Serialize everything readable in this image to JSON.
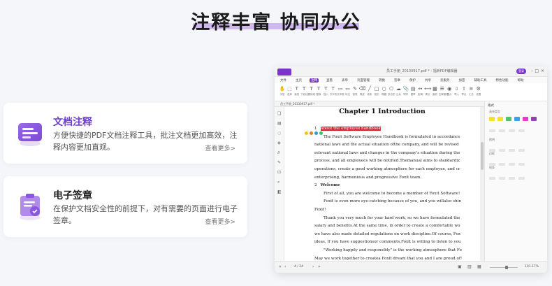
{
  "header": {
    "title": "注释丰富 协同办公"
  },
  "features": [
    {
      "title": "文档注释",
      "description": "方便快捷的PDF文档注释工具，批注文档更加高效，注释内容更加直观。",
      "link": "查看更多>",
      "icon": "annotation-icon",
      "accent": "#7b44d6"
    },
    {
      "title": "电子签章",
      "description": "在保护文档安全性的前提下，对有需要的页面进行电子签章。",
      "link": "查看更多>",
      "icon": "stamp-icon",
      "accent": "#9a6de3"
    }
  ],
  "app": {
    "window_title": "员工手册_20130917.pdf * - 福昕PDF编辑器",
    "login_label": "登录",
    "menus": [
      "文件",
      "主页",
      "注释",
      "查看",
      "表单",
      "页面管理",
      "转换",
      "签章",
      "保护",
      "共享",
      "云服务",
      "加密",
      "辅助工具",
      "特色功能",
      "帮助"
    ],
    "active_menu": "注释",
    "tools": [
      {
        "label": "手型",
        "glyph": "✋"
      },
      {
        "label": "选择",
        "glyph": "⬚"
      },
      {
        "label": "高亮",
        "glyph": "T"
      },
      {
        "label": "下划线",
        "glyph": "T"
      },
      {
        "label": "删除线",
        "glyph": "T"
      },
      {
        "label": "替换",
        "glyph": "T"
      },
      {
        "label": "插入",
        "glyph": "T"
      },
      {
        "label": "打字机",
        "glyph": "T"
      },
      {
        "label": "文本框",
        "glyph": "▭"
      },
      {
        "label": "标注",
        "glyph": "▭"
      },
      {
        "label": "铅笔",
        "glyph": "✎"
      },
      {
        "label": "橡皮",
        "glyph": "⌫"
      },
      {
        "label": "线条",
        "glyph": "╱"
      },
      {
        "label": "矩形",
        "glyph": "□"
      },
      {
        "label": "椭圆",
        "glyph": "○"
      },
      {
        "label": "多边形",
        "glyph": "⬠"
      },
      {
        "label": "云朵",
        "glyph": "☁"
      },
      {
        "label": "附件",
        "glyph": "📎"
      },
      {
        "label": "图章",
        "glyph": "▤"
      },
      {
        "label": "距离",
        "glyph": "↔"
      },
      {
        "label": "周长",
        "glyph": "⟷"
      },
      {
        "label": "面积",
        "glyph": "▦"
      },
      {
        "label": "注释管理",
        "glyph": "☰"
      },
      {
        "label": "显示",
        "glyph": "◉"
      },
      {
        "label": "导入",
        "glyph": "⇩"
      },
      {
        "label": "导出",
        "glyph": "⇧"
      },
      {
        "label": "汇总",
        "glyph": "≡"
      },
      {
        "label": "设置",
        "glyph": "⚙"
      }
    ],
    "doc_tab": "员工手册_20130917.pdf *",
    "right_panel": {
      "title": "格式",
      "section1": "高亮类型",
      "section2": "透明",
      "section3": "边框",
      "section4": "线条",
      "swatches": [
        "#f5e12a",
        "#f5e12a",
        "#4fc36b",
        "#3aa0e8",
        "#e83ac8",
        "#8e44ad"
      ]
    },
    "document": {
      "chapter": "Chapter 1 Introduction",
      "lines": [
        {
          "num": "1",
          "text": "About the employee handbook",
          "highlight": true
        },
        {
          "text": "The Foxit Software Employee Handbook is formulated in accordance"
        },
        {
          "text": "national laws and the actual situation ofthe company, and will be revised"
        },
        {
          "text": "relevant national laws and changes in the company's situation during the"
        },
        {
          "text": "process, and all employees will be notified.Themanual aims to standardiz"
        },
        {
          "text": "operations, create a good working atmosphere for each employee, and cr"
        },
        {
          "text": "enterprising, harmonious and progressive Foxit team."
        },
        {
          "num": "2",
          "text": "Welcome",
          "bold": true
        },
        {
          "text": "First of all, you are welcome to become a member of Foxit Software!"
        },
        {
          "text": "Foxit is even more eye-catching because of you, and you willalso shin"
        },
        {
          "text": "Foxit!"
        },
        {
          "text": "Thank you very much for your hard work, so we have formulated the"
        },
        {
          "text": "salary and benefits.At the same time, in order to create a comfortable wo"
        },
        {
          "text": "we have also made detailed regulations on work discipline.Of course, Fox"
        },
        {
          "text": "ideas. If you have suggestionsor comments,Foxit is willing to listen to you"
        },
        {
          "text": "\"Working happily and responsibly\" is the working atmosphere that Fo"
        },
        {
          "text": "May we work together to createa Foxit dream that you and I are proud of!"
        }
      ]
    },
    "status": {
      "page": "4 / 24",
      "zoom": "101.17%"
    }
  }
}
